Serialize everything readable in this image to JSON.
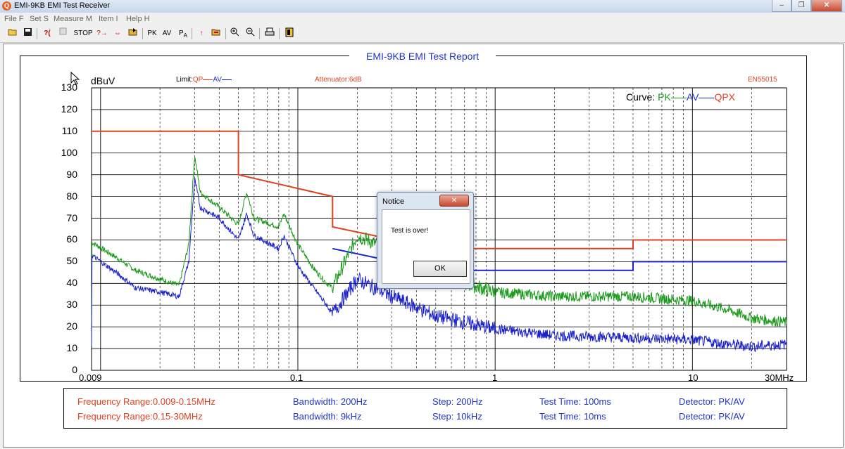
{
  "window": {
    "title": "EMI-9KB EMI Test Receiver",
    "icon": "app-icon"
  },
  "window_buttons": {
    "minimize": "minimize-icon",
    "maximize": "restore-icon",
    "close": "close-icon"
  },
  "menu": [
    "File F",
    "Set S",
    "Measure M",
    "Item I",
    "Help H"
  ],
  "toolbar": {
    "stop": "STOP",
    "pk": "PK",
    "av": "AV",
    "pa": "P",
    "pa_sub": "A",
    "icons": [
      "open-folder-icon",
      "save-icon",
      "help-icon",
      "blank-icon",
      "read-icon",
      "arrows-icon",
      "export-icon",
      "up-arrow-icon",
      "import-icon",
      "zoom-in-icon",
      "zoom-out-icon",
      "print-icon",
      "exit-door-icon"
    ]
  },
  "report": {
    "title": "EMI-9KB EMI Test Report",
    "unit": "dBuV",
    "limit_label": "Limit:",
    "limit_qp": "QP",
    "limit_av": "AV",
    "attenuator": "Attenuator:6dB",
    "standard": "EN55015",
    "curve_label": "Curve:",
    "curve_pk": "PK",
    "curve_av": "AV",
    "curve_qp": "QPX",
    "colors": {
      "pk": "#1a9a1a",
      "av": "#1a22cc",
      "qp": "#e04020",
      "title": "#2233cc"
    }
  },
  "chart_data": {
    "type": "line",
    "xscale": "log",
    "xlim": [
      0.009,
      30
    ],
    "ylim": [
      0,
      130
    ],
    "yticks": [
      0,
      10,
      20,
      30,
      40,
      50,
      60,
      70,
      80,
      90,
      100,
      110,
      120,
      130
    ],
    "xtick_labels": [
      "0.009",
      "0.1",
      "1",
      "10",
      "30MHz"
    ],
    "ylabel": "dBuV",
    "grid": true,
    "series": [
      {
        "name": "QP",
        "values": [
          [
            0.009,
            110
          ],
          [
            0.05,
            110
          ],
          [
            0.05,
            90
          ],
          [
            0.15,
            80
          ],
          [
            0.15,
            66
          ],
          [
            0.5,
            56
          ],
          [
            5,
            56
          ],
          [
            5,
            60
          ],
          [
            30,
            60
          ]
        ]
      },
      {
        "name": "AV",
        "values": [
          [
            0.15,
            56
          ],
          [
            0.5,
            46
          ],
          [
            5,
            46
          ],
          [
            5,
            50
          ],
          [
            30,
            50
          ]
        ]
      },
      {
        "name": "PK",
        "values": [
          [
            0.009,
            59
          ],
          [
            0.012,
            52
          ],
          [
            0.015,
            46
          ],
          [
            0.02,
            42
          ],
          [
            0.025,
            39
          ],
          [
            0.028,
            58
          ],
          [
            0.03,
            99
          ],
          [
            0.032,
            82
          ],
          [
            0.04,
            75
          ],
          [
            0.05,
            67
          ],
          [
            0.055,
            82
          ],
          [
            0.06,
            70
          ],
          [
            0.08,
            66
          ],
          [
            0.085,
            72
          ],
          [
            0.1,
            58
          ],
          [
            0.12,
            47
          ],
          [
            0.14,
            40
          ],
          [
            0.15,
            38
          ],
          [
            0.2,
            62
          ],
          [
            0.3,
            55
          ],
          [
            0.4,
            50
          ],
          [
            0.6,
            42
          ],
          [
            1,
            36
          ],
          [
            2,
            34
          ],
          [
            5,
            34
          ],
          [
            10,
            32
          ],
          [
            15,
            28
          ],
          [
            20,
            24
          ],
          [
            30,
            22
          ]
        ]
      },
      {
        "name": "AV",
        "values": [
          [
            0.009,
            53
          ],
          [
            0.012,
            45
          ],
          [
            0.015,
            38
          ],
          [
            0.02,
            36
          ],
          [
            0.025,
            34
          ],
          [
            0.028,
            50
          ],
          [
            0.03,
            88
          ],
          [
            0.032,
            75
          ],
          [
            0.04,
            70
          ],
          [
            0.05,
            60
          ],
          [
            0.055,
            72
          ],
          [
            0.06,
            62
          ],
          [
            0.08,
            56
          ],
          [
            0.085,
            62
          ],
          [
            0.1,
            48
          ],
          [
            0.12,
            38
          ],
          [
            0.14,
            30
          ],
          [
            0.15,
            26
          ],
          [
            0.2,
            42
          ],
          [
            0.3,
            34
          ],
          [
            0.5,
            25
          ],
          [
            1,
            19
          ],
          [
            2,
            16
          ],
          [
            5,
            15
          ],
          [
            10,
            14
          ],
          [
            15,
            12
          ],
          [
            20,
            11
          ],
          [
            30,
            12
          ]
        ]
      }
    ]
  },
  "info": {
    "rows": [
      {
        "freq": "Frequency Range:0.009-0.15MHz",
        "bw": "Bandwidth: 200Hz",
        "step": "Step: 200Hz",
        "time": "Test Time: 100ms",
        "det": "Detector: PK/AV"
      },
      {
        "freq": "Frequency Range:0.15-30MHz",
        "bw": "Bandwidth: 9kHz",
        "step": "Step: 10kHz",
        "time": "Test Time: 10ms",
        "det": "Detector: PK/AV"
      }
    ]
  },
  "dialog": {
    "title": "Notice",
    "message": "Test is over!",
    "ok": "OK",
    "close_icon": "close-icon"
  }
}
